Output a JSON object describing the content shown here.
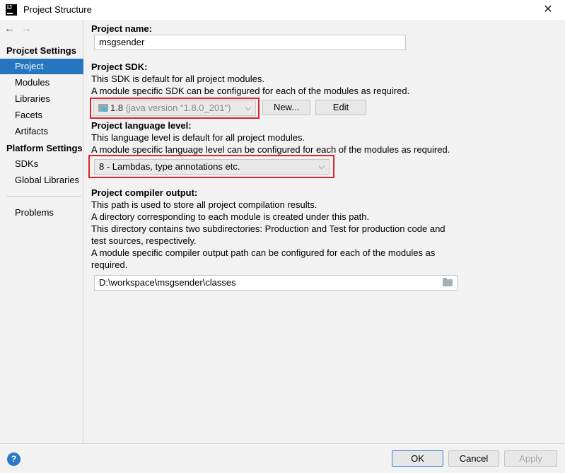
{
  "window": {
    "title": "Project Structure",
    "app_icon_text": "IJ",
    "close_glyph": "✕"
  },
  "nav": {
    "back_glyph": "←",
    "forward_glyph": "→"
  },
  "sidebar": {
    "project_settings_title": "Projcet Settings",
    "project_settings_items": [
      "Project",
      "Modules",
      "Libraries",
      "Facets",
      "Artifacts"
    ],
    "platform_settings_title": "Platform Settings",
    "platform_settings_items": [
      "SDKs",
      "Global Libraries"
    ],
    "problems_label": "Problems",
    "selected_item": "Project"
  },
  "content": {
    "project_name_label": "Project name:",
    "project_name_value": "msgsender",
    "sdk_label": "Project SDK:",
    "sdk_desc_1": "This SDK is default for all project modules.",
    "sdk_desc_2": "A module specific SDK can be configured for each of the modules as required.",
    "sdk_version": "1.8",
    "sdk_detail": "(java version \"1.8.0_201\")",
    "new_button": "New...",
    "edit_button": "Edit",
    "lang_label": "Project language level:",
    "lang_desc_1": "This language level is default for all project modules.",
    "lang_desc_2": "A module specific language level can be configured for each of the modules as required.",
    "lang_value": "8 - Lambdas, type annotations etc.",
    "output_label": "Project compiler output:",
    "output_desc_1": "This path is used to store all project compilation results.",
    "output_desc_2": "A directory corresponding to each module is created under this path.",
    "output_desc_3": "This directory contains two subdirectories: Production and Test for production code and",
    "output_desc_4": "test sources, respectively.",
    "output_desc_5": "A module specific compiler output path can be configured for each of the modules as",
    "output_desc_6": "required.",
    "output_path": "D:\\workspace\\msgsender\\classes"
  },
  "footer": {
    "help_glyph": "?",
    "ok": "OK",
    "cancel": "Cancel",
    "apply": "Apply"
  },
  "colors": {
    "selection": "#2675bf",
    "highlight_box": "#e0202a",
    "help_icon": "#2a78c8"
  }
}
